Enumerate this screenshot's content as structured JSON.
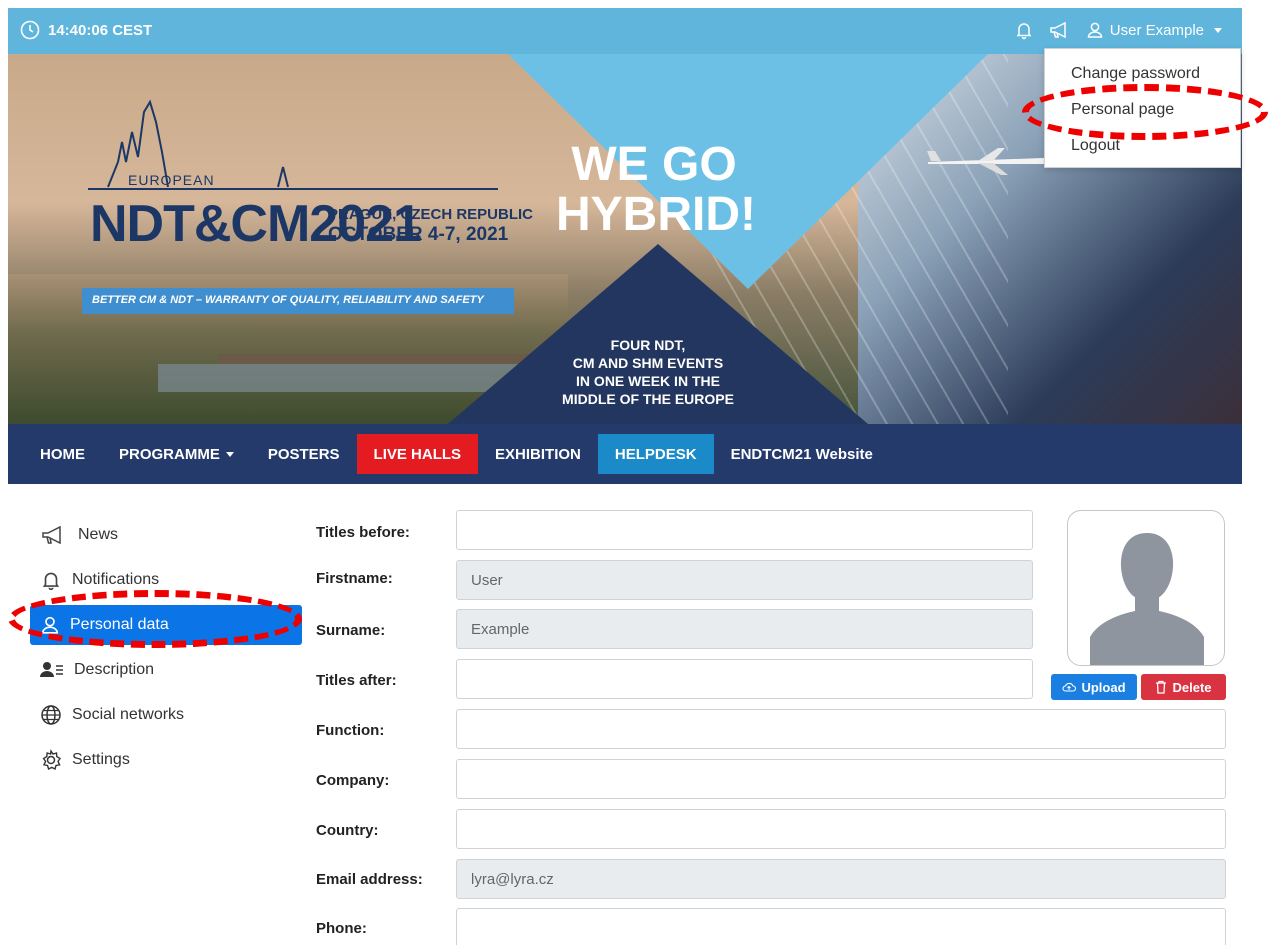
{
  "topbar": {
    "time": "14:40:06 CEST",
    "user_name": "User Example"
  },
  "user_menu": {
    "items": [
      "Change password",
      "Personal page",
      "Logout"
    ]
  },
  "banner": {
    "europe_label": "EUROPEAN",
    "event_name": "NDT&CM2021",
    "location": "PRAGUE, CZECH REPUBLIC",
    "dates": "OCTOBER 4-7, 2021",
    "tagline": "BETTER CM & NDT – WARRANTY OF QUALITY, RELIABILITY AND SAFETY",
    "headline_1": "WE GO",
    "headline_2": "HYBRID!",
    "subline": [
      "FOUR NDT,",
      "CM AND SHM EVENTS",
      "IN ONE WEEK IN THE",
      "MIDDLE OF THE EUROPE"
    ]
  },
  "nav": {
    "items": [
      "HOME",
      "PROGRAMME",
      "POSTERS",
      "LIVE HALLS",
      "EXHIBITION",
      "HELPDESK",
      "ENDTCM21 Website"
    ],
    "live_color": "#e41c22",
    "help_color": "#1a8ac8"
  },
  "sidebar": {
    "items": [
      "News",
      "Notifications",
      "Personal data",
      "Description",
      "Social networks",
      "Settings"
    ],
    "active": "Personal data"
  },
  "form": {
    "labels": [
      "Titles before:",
      "Firstname:",
      "Surname:",
      "Titles after:",
      "Function:",
      "Company:",
      "Country:",
      "Email address:",
      "Phone:"
    ],
    "values": {
      "firstname": "User",
      "surname": "Example",
      "email": "lyra@lyra.cz"
    }
  },
  "avatar": {
    "upload_label": "Upload",
    "delete_label": "Delete"
  },
  "colors": {
    "topbar": "#5fb5dc",
    "nav": "#243a6b",
    "active_sidebar": "#0b74e6",
    "annotation": "#ee0000"
  }
}
